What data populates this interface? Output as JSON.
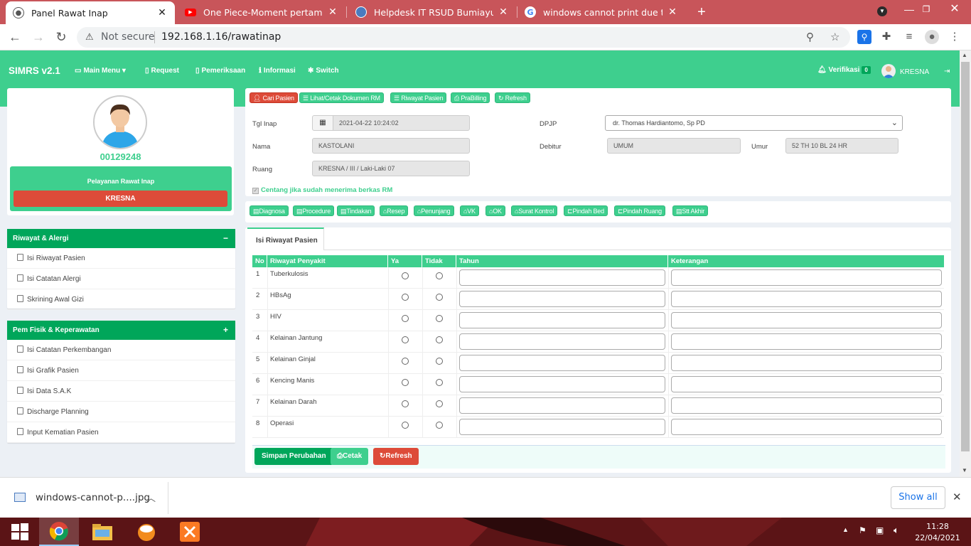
{
  "browser": {
    "tabs": [
      {
        "title": "Panel Rawat Inap",
        "active": true,
        "icon": "globe-icon"
      },
      {
        "title": "One Piece-Moment pertama kali",
        "active": false,
        "icon": "youtube-icon"
      },
      {
        "title": "Helpdesk IT RSUD Bumiayu |",
        "active": false,
        "icon": "helpdesk-icon"
      },
      {
        "title": "windows cannot print due to a pr",
        "active": false,
        "icon": "google-icon"
      }
    ],
    "security_label": "Not secure",
    "url": "192.168.1.16/rawatinap"
  },
  "app": {
    "brand": "SIMRS v2.1",
    "nav": [
      {
        "label": "Main Menu",
        "icon": "folder-icon",
        "dropdown": true
      },
      {
        "label": "Request",
        "icon": "file-icon"
      },
      {
        "label": "Pemeriksaan",
        "icon": "file-icon"
      },
      {
        "label": "Informasi",
        "icon": "info-icon"
      },
      {
        "label": "Switch",
        "icon": "users-icon"
      }
    ],
    "verifikasi_label": "Verifikasi",
    "verifikasi_count": "0",
    "user": "KRESNA",
    "colors": {
      "primary": "#3ecf8e",
      "dark_green": "#00a65a",
      "danger": "#dd4b39"
    }
  },
  "profile": {
    "mrn": "00129248",
    "service_label": "Pelayanan Rawat Inap",
    "ward_button": "KRESNA"
  },
  "sidebar": {
    "riwayat": {
      "title": "Riwayat & Alergi",
      "toggle": "−",
      "items": [
        "Isi Riwayat Pasien",
        "Isi Catatan Alergi",
        "Skrining Awal Gizi"
      ]
    },
    "pemfisik": {
      "title": "Pem Fisik & Keperawatan",
      "toggle": "+",
      "items": [
        "Isi Catatan Perkembangan",
        "Isi Grafik Pasien",
        "Isi Data S.A.K",
        "Discharge Planning",
        "Input Kematian Pasien"
      ]
    }
  },
  "toolbar_buttons": {
    "cari": "Cari Pasien",
    "lihat": "Lihat/Cetak Dokumen RM",
    "riwayat": "Riwayat Pasien",
    "prabilling": "PraBilling",
    "refresh": "Refresh"
  },
  "patient": {
    "tgl_inap_label": "Tgl Inap",
    "tgl_inap": "2021-04-22 10:24:02",
    "nama_label": "Nama",
    "nama": "KASTOLANI",
    "ruang_label": "Ruang",
    "ruang": "KRESNA / III / Laki-Laki 07",
    "dpjp_label": "DPJP",
    "dpjp": "dr. Thomas Hardiantomo, Sp PD",
    "debitur_label": "Debitur",
    "debitur": "UMUM",
    "umur_label": "Umur",
    "umur": "52 TH 10 BL 24 HR",
    "checkbox_label": "Centang jika sudah menerima berkas RM"
  },
  "action_buttons": [
    "Diagnosa",
    "Procedure",
    "Tindakan",
    "Resep",
    "Penunjang",
    "VK",
    "OK",
    "Surat Kontrol",
    "Pindah Bed",
    "Pindah Ruang",
    "Stt Akhir"
  ],
  "content": {
    "tab": "Isi Riwayat Pasien",
    "table": {
      "headers": [
        "No",
        "Riwayat Penyakit",
        "Ya",
        "Tidak",
        "Tahun",
        "Keterangan"
      ],
      "rows": [
        {
          "no": "1",
          "name": "Tuberkulosis"
        },
        {
          "no": "2",
          "name": "HBsAg"
        },
        {
          "no": "3",
          "name": "HIV"
        },
        {
          "no": "4",
          "name": "Kelainan Jantung"
        },
        {
          "no": "5",
          "name": "Kelainan Ginjal"
        },
        {
          "no": "6",
          "name": "Kencing Manis"
        },
        {
          "no": "7",
          "name": "Kelainan Darah"
        },
        {
          "no": "8",
          "name": "Operasi"
        }
      ]
    },
    "footer_buttons": {
      "save": "Simpan Perubahan",
      "print": "Cetak",
      "refresh": "Refresh"
    }
  },
  "downloads": {
    "file": "windows-cannot-p....jpg",
    "show_all": "Show all"
  },
  "taskbar": {
    "time": "11:28",
    "date": "22/04/2021"
  }
}
